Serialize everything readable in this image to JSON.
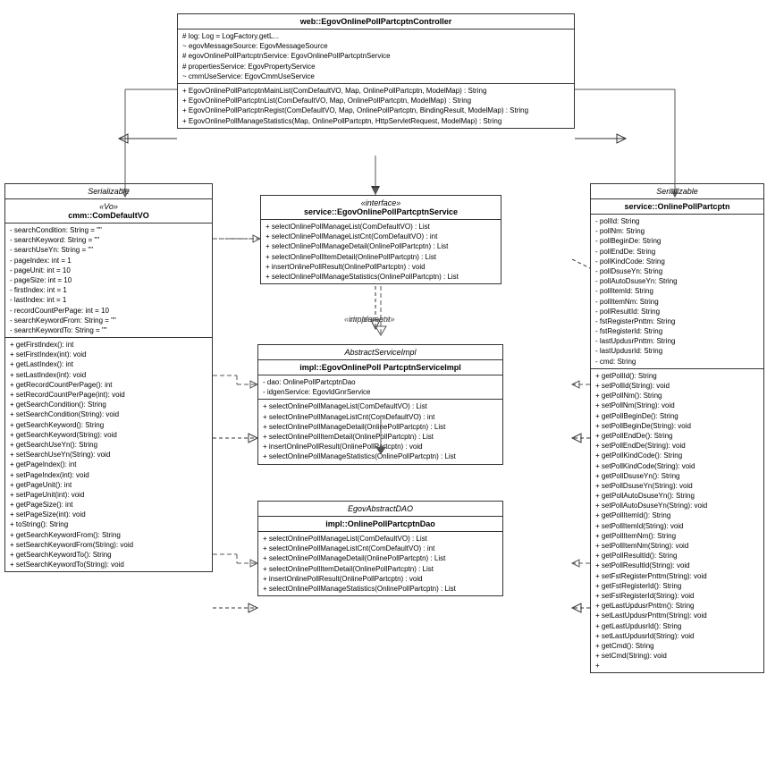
{
  "controller": {
    "title": "web::EgovOnlinePollPartcptnController",
    "attributes": [
      {
        "vis": "protected",
        "text": "log: Log = LogFactory.getL..."
      },
      {
        "vis": "package",
        "text": "egovMessageSource: EgovMessageSource"
      },
      {
        "vis": "protected",
        "text": "egovOnlinePollPartcptnService: EgovOnlinePollPartcptnService"
      },
      {
        "vis": "protected",
        "text": "propertiesService: EgovPropertyService"
      },
      {
        "vis": "package",
        "text": "cmmUseService: EgovCmmUseService"
      }
    ],
    "methods": [
      {
        "vis": "public",
        "text": "EgovOnlinePollPartcptnMainList(ComDefaultVO, Map, OnlinePollPartcptn, ModelMap) : String"
      },
      {
        "vis": "public",
        "text": "EgovOnlinePollPartcptnList(ComDefaultVO, Map, OnlinePollPartcptn, ModelMap) : String"
      },
      {
        "vis": "public",
        "text": "EgovOnlinePollPartcptnRegist(ComDefaultVO, Map, OnlinePollPartcptn, BindingResult, ModelMap) : String"
      },
      {
        "vis": "public",
        "text": "EgovOnlinePollManageStatistics(Map, OnlinePollPartcptn, HttpServletRequest, ModelMap) : String"
      }
    ]
  },
  "service_interface": {
    "stereotype": "«interface»",
    "title": "service::EgovOnlinePollPartcptnService",
    "methods": [
      {
        "vis": "public",
        "text": "selectOnlinePollManageList(ComDefaultVO) : List"
      },
      {
        "vis": "public",
        "text": "selectOnlinePollManageListCnt(ComDefaultVO) : int"
      },
      {
        "vis": "public",
        "text": "selectOnlinePollManageDetail(OnlinePollPartcptn) : List"
      },
      {
        "vis": "public",
        "text": "selectOnlinePollItemDetail(OnlinePollPartcptn) : List"
      },
      {
        "vis": "public",
        "text": "insertOnlinePollResult(OnlinePollPartcptn) : void"
      },
      {
        "vis": "public",
        "text": "selectOnlinePollManageStatistics(OnlinePollPartcptn) : List"
      }
    ]
  },
  "service_impl": {
    "stereotype_top": "AbstractServiceImpl",
    "title": "impl::EgovOnlinePoll PartcptnServiceImpl",
    "attributes": [
      {
        "vis": "private",
        "text": "dao: OnlinePollPartcptnDao"
      },
      {
        "vis": "private",
        "text": "idgenService: EgovIdGnrService"
      }
    ],
    "methods": [
      {
        "vis": "public",
        "text": "selectOnlinePollManageList(ComDefaultVO) : List"
      },
      {
        "vis": "public",
        "text": "selectOnlinePollManageListCnt(ComDefaultVO) : int"
      },
      {
        "vis": "public",
        "text": "selectOnlinePollManageDetail(OnlinePollPartcptn) : List"
      },
      {
        "vis": "public",
        "text": "selectOnlinePollItemDetail(OnlinePollPartcptn) : List"
      },
      {
        "vis": "public",
        "text": "insertOnlinePollResult(OnlinePollPartcptn) : void"
      },
      {
        "vis": "public",
        "text": "selectOnlinePollManageStatistics(OnlinePollPartcptn) : List"
      }
    ]
  },
  "dao": {
    "stereotype_top": "EgovAbstractDAO",
    "title": "impl::OnlinePollPartcptnDao",
    "methods": [
      {
        "vis": "public",
        "text": "selectOnlinePollManageList(ComDefaultVO) : List"
      },
      {
        "vis": "public",
        "text": "selectOnlinePollManageListCnt(ComDefaultVO) : int"
      },
      {
        "vis": "public",
        "text": "selectOnlinePollManageDetail(OnlinePollPartcptn) : List"
      },
      {
        "vis": "public",
        "text": "selectOnlinePollItemDetail(OnlinePollPartcptn) : List"
      },
      {
        "vis": "public",
        "text": "insertOnlinePollResult(OnlinePollPartcptn) : void"
      },
      {
        "vis": "public",
        "text": "selectOnlinePollManageStatistics(OnlinePollPartcptn) : List"
      }
    ]
  },
  "com_default_vo": {
    "stereotype": "«Vo»",
    "title": "cmm::ComDefaultVO",
    "impl": "Serializable",
    "attributes": [
      {
        "vis": "private",
        "text": "searchCondition: String = \"\""
      },
      {
        "vis": "private",
        "text": "searchKeyword: String = \"\""
      },
      {
        "vis": "private",
        "text": "searchUseYn: String = \"\""
      },
      {
        "vis": "private",
        "text": "pageIndex: int = 1"
      },
      {
        "vis": "private",
        "text": "pageUnit: int = 10"
      },
      {
        "vis": "private",
        "text": "pageSize: int = 10"
      },
      {
        "vis": "private",
        "text": "firstIndex: int = 1"
      },
      {
        "vis": "private",
        "text": "lastIndex: int = 1"
      },
      {
        "vis": "private",
        "text": "recordCountPerPage: int = 10"
      },
      {
        "vis": "private",
        "text": "searchKeywordFrom: String = \"\""
      },
      {
        "vis": "private",
        "text": "searchKeywordTo: String = \"\""
      }
    ],
    "methods": [
      {
        "vis": "public",
        "text": "getFirstIndex(): int"
      },
      {
        "vis": "public",
        "text": "setFirstIndex(int): void"
      },
      {
        "vis": "public",
        "text": "getLastIndex(): int"
      },
      {
        "vis": "public",
        "text": "setLastIndex(int): void"
      },
      {
        "vis": "public",
        "text": "getRecordCountPerPage(): int"
      },
      {
        "vis": "public",
        "text": "setRecordCountPerPage(int): void"
      },
      {
        "vis": "public",
        "text": "getSearchCondition(): String"
      },
      {
        "vis": "public",
        "text": "setSearchCondition(String): void"
      },
      {
        "vis": "public",
        "text": "getSearchKeyword(): String"
      },
      {
        "vis": "public",
        "text": "getSearchKeyword(String): void"
      },
      {
        "vis": "public",
        "text": "getSearchUseYn(): String"
      },
      {
        "vis": "public",
        "text": "setSearchUseYn(String): void"
      },
      {
        "vis": "public",
        "text": "getPageIndex(): int"
      },
      {
        "vis": "public",
        "text": "setPageIndex(int): void"
      },
      {
        "vis": "public",
        "text": "getPageUnit(): int"
      },
      {
        "vis": "public",
        "text": "setPageUnit(int): void"
      },
      {
        "vis": "public",
        "text": "getPageSize(): int"
      },
      {
        "vis": "public",
        "text": "setPageSize(int): void"
      },
      {
        "vis": "public",
        "text": "toString(): String"
      },
      {
        "vis": "public",
        "text": "getSearchKeywordFrom(): String"
      },
      {
        "vis": "public",
        "text": "setSearchKeywordFrom(String): void"
      },
      {
        "vis": "public",
        "text": "getSearchKeywordTo(): String"
      },
      {
        "vis": "public",
        "text": "setSearchKeywordTo(String): void"
      }
    ]
  },
  "online_poll": {
    "impl": "Serializable",
    "title": "service::OnlinePollPartcptn",
    "attributes": [
      {
        "vis": "private",
        "text": "pollId: String"
      },
      {
        "vis": "private",
        "text": "pollNm: String"
      },
      {
        "vis": "private",
        "text": "pollBeginDe: String"
      },
      {
        "vis": "private",
        "text": "pollEndDe: String"
      },
      {
        "vis": "private",
        "text": "pollKindCode: String"
      },
      {
        "vis": "private",
        "text": "pollDsuseYn: String"
      },
      {
        "vis": "private",
        "text": "pollAutoDsuseYn: String"
      },
      {
        "vis": "private",
        "text": "pollItemId: String"
      },
      {
        "vis": "private",
        "text": "pollItemNm: String"
      },
      {
        "vis": "private",
        "text": "pollResultId: String"
      },
      {
        "vis": "private",
        "text": "fstRegisterPnttm: String"
      },
      {
        "vis": "private",
        "text": "fstRegisterId: String"
      },
      {
        "vis": "private",
        "text": "lastUpdusrPnttm: String"
      },
      {
        "vis": "private",
        "text": "lastUpdusrId: String"
      },
      {
        "vis": "private",
        "text": "cmd: String"
      }
    ],
    "methods": [
      {
        "vis": "public",
        "text": "getPollId(): String"
      },
      {
        "vis": "public",
        "text": "setPollId(String): void"
      },
      {
        "vis": "public",
        "text": "getPollNm(): String"
      },
      {
        "vis": "public",
        "text": "setPollNm(String): void"
      },
      {
        "vis": "public",
        "text": "getPollBeginDe(): String"
      },
      {
        "vis": "public",
        "text": "setPollBeginDe(String): void"
      },
      {
        "vis": "public",
        "text": "getPollEndDe(): String"
      },
      {
        "vis": "public",
        "text": "setPollEndDe(String): void"
      },
      {
        "vis": "public",
        "text": "getPollKindCode(): String"
      },
      {
        "vis": "public",
        "text": "setPollKindCode(String): void"
      },
      {
        "vis": "public",
        "text": "getPollDsuseYn(): String"
      },
      {
        "vis": "public",
        "text": "setPollDsuseYn(String): void"
      },
      {
        "vis": "public",
        "text": "getPollAutoDsuseYn(): String"
      },
      {
        "vis": "public",
        "text": "setPollAutoDsuseYn(String): void"
      },
      {
        "vis": "public",
        "text": "getPollItemId(): String"
      },
      {
        "vis": "public",
        "text": "setPollItemId(String): void"
      },
      {
        "vis": "public",
        "text": "getPollItemNm(): String"
      },
      {
        "vis": "public",
        "text": "setPollItemNm(String): void"
      },
      {
        "vis": "public",
        "text": "getPollResultId(): String"
      },
      {
        "vis": "public",
        "text": "setPollResultId(String): void"
      },
      {
        "vis": "public",
        "text": "setFstRegisterPnttm(String): void"
      },
      {
        "vis": "public",
        "text": "getFstRegisterId(): String"
      },
      {
        "vis": "public",
        "text": "setFstRegisterId(String): void"
      },
      {
        "vis": "public",
        "text": "getLastUpdusrPnttm(): String"
      },
      {
        "vis": "public",
        "text": "setLastUpdusrPnttm(String): void"
      },
      {
        "vis": "public",
        "text": "getLastUpdusrId(): String"
      },
      {
        "vis": "public",
        "text": "setLastUpdusrId(String): void"
      },
      {
        "vis": "public",
        "text": "getCmd(): String"
      },
      {
        "vis": "public",
        "text": "setCmd(String): void"
      }
    ]
  }
}
